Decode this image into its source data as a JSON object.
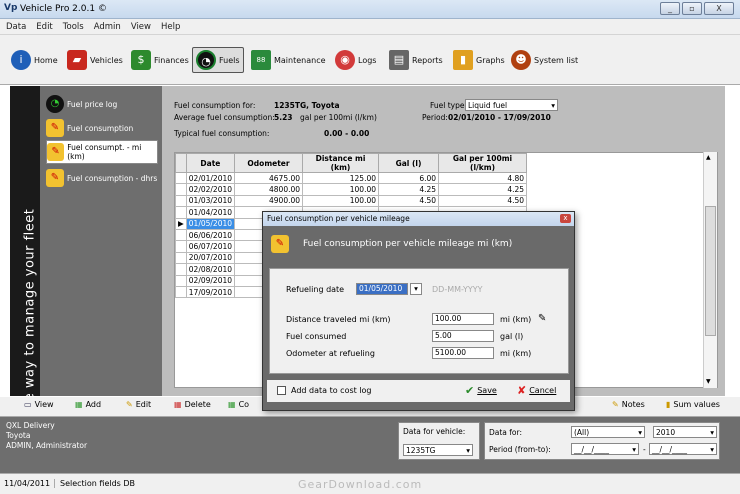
{
  "window": {
    "logo": "Vp",
    "title": "Vehicle Pro 2.0.1 ©",
    "controls": [
      "_",
      "▫",
      "X"
    ]
  },
  "menu": [
    "Data",
    "Edit",
    "Tools",
    "Admin",
    "View",
    "Help"
  ],
  "toolbar": [
    {
      "label": "Home",
      "icon": "info-icon",
      "color": "#1f5fb8"
    },
    {
      "label": "Vehicles",
      "icon": "car-icon",
      "color": "#c8281e"
    },
    {
      "label": "Finances",
      "icon": "money-icon",
      "color": "#2d8a2d"
    },
    {
      "label": "Fuels",
      "icon": "fuel-gauge-icon",
      "color": "#1a7f2e"
    },
    {
      "label": "Maintenance",
      "icon": "meter-icon",
      "color": "#2a8a3c"
    },
    {
      "label": "Logs",
      "icon": "disk-icon",
      "color": "#d23a3a"
    },
    {
      "label": "Reports",
      "icon": "printer-icon",
      "color": "#555555"
    },
    {
      "label": "Graphs",
      "icon": "chart-icon",
      "color": "#e0a020"
    },
    {
      "label": "System list",
      "icon": "person-icon",
      "color": "#b04010"
    }
  ],
  "brand_vertical": "The way to manage your fleet",
  "nav": [
    {
      "label": "Fuel price log",
      "icon": "gauge-icon",
      "selected": false
    },
    {
      "label": "Fuel consumption",
      "icon": "pencil-icon",
      "selected": false
    },
    {
      "label": "Fuel consumpt. - mi (km)",
      "icon": "pencil-icon",
      "selected": true
    },
    {
      "label": "Fuel consumption - dhrs",
      "icon": "pencil-icon",
      "selected": false
    }
  ],
  "info": {
    "for_label": "Fuel consumption for:",
    "vehicle": "1235TG, Toyota",
    "fueltype_label": "Fuel type:",
    "fueltype": "Liquid fuel",
    "avg_label": "Average fuel consumption:",
    "avg_value": "5.23",
    "avg_unit": "gal per 100mi (l/km)",
    "period_label": "Period:",
    "period": "02/01/2010 - 17/09/2010",
    "typical_label": "Typical fuel consumption:",
    "typical_value": "0.00 - 0.00"
  },
  "grid": {
    "headers": [
      "Date",
      "Odometer",
      "Distance mi (km)",
      "Gal (l)",
      "Gal per 100mi (l/km)"
    ],
    "rows": [
      [
        "02/01/2010",
        "4675.00",
        "125.00",
        "6.00",
        "4.80"
      ],
      [
        "02/02/2010",
        "4800.00",
        "100.00",
        "4.25",
        "4.25"
      ],
      [
        "01/03/2010",
        "4900.00",
        "100.00",
        "4.50",
        "4.50"
      ],
      [
        "01/04/2010",
        "",
        "",
        "",
        ""
      ],
      [
        "01/05/2010",
        "",
        "",
        "",
        ""
      ],
      [
        "06/06/2010",
        "",
        "",
        "",
        ""
      ],
      [
        "06/07/2010",
        "",
        "",
        "",
        ""
      ],
      [
        "20/07/2010",
        "",
        "",
        "",
        ""
      ],
      [
        "02/08/2010",
        "",
        "",
        "",
        ""
      ],
      [
        "02/09/2010",
        "",
        "",
        "",
        ""
      ],
      [
        "17/09/2010",
        "",
        "",
        "",
        ""
      ]
    ],
    "selected_row": 4
  },
  "actions": {
    "view": "View",
    "add": "Add",
    "edit": "Edit",
    "delete": "Delete",
    "copy": "Co",
    "notes": "Notes",
    "sum": "Sum values"
  },
  "bottom": {
    "company": "QXL Delivery",
    "make": "Toyota",
    "user": "ADMIN, Administrator",
    "vehicle_label": "Data for vehicle:",
    "vehicle_value": "1235TG",
    "datafor_label": "Data for:",
    "datafor_value": "(All)",
    "year": "2010",
    "period_label": "Period (from-to):",
    "date_from": "__/__/____",
    "date_sep": "-",
    "date_to": "__/__/____"
  },
  "status": {
    "date": "11/04/2011",
    "msg": "Selection fields DB"
  },
  "dialog": {
    "title": "Fuel consumption per vehicle mileage",
    "heading": "Fuel consumption per vehicle mileage mi (km)",
    "refuel_label": "Refueling date",
    "refuel_value": "01/05/2010",
    "refuel_hint": "DD-MM-YYYY",
    "dist_label": "Distance traveled mi (km)",
    "dist_value": "100.00",
    "dist_unit": "mi (km)",
    "fuel_label": "Fuel consumed",
    "fuel_value": "5.00",
    "fuel_unit": "gal (l)",
    "odo_label": "Odometer at refueling",
    "odo_value": "5100.00",
    "odo_unit": "mi (km)",
    "cost_label": "Add data to cost log",
    "save": "Save",
    "cancel": "Cancel"
  },
  "watermark": "GearDownload.com"
}
